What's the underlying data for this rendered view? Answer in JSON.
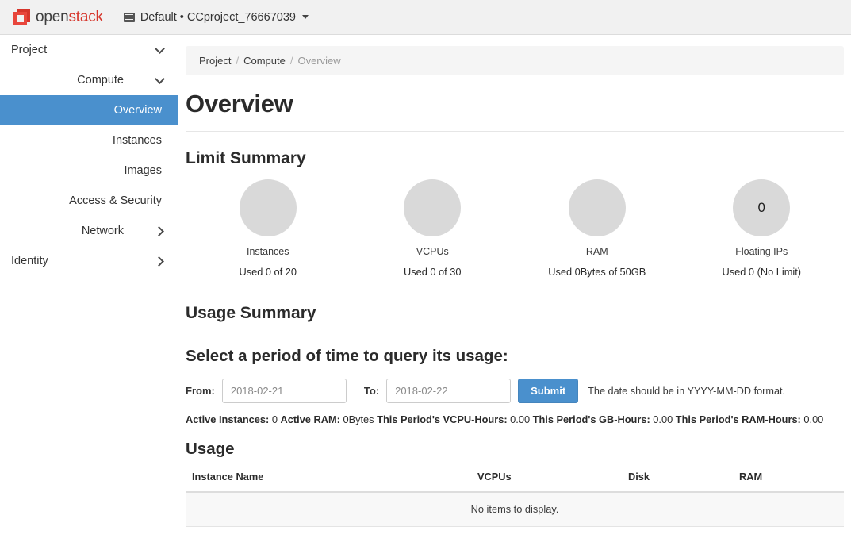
{
  "topbar": {
    "logo_open": "open",
    "logo_stack": "stack",
    "logo_icon": "openstack-cube-icon",
    "switcher_icon": "th-list-icon",
    "switcher_label": "Default • CCproject_76667039",
    "caret_icon": "caret-down-icon"
  },
  "sidebar": {
    "items": [
      {
        "label": "Project",
        "level": 0,
        "chevron": "down",
        "active": false
      },
      {
        "label": "Compute",
        "level": 1,
        "chevron": "down",
        "active": false
      },
      {
        "label": "Overview",
        "level": 2,
        "chevron": "none",
        "active": true
      },
      {
        "label": "Instances",
        "level": 2,
        "chevron": "none",
        "active": false
      },
      {
        "label": "Images",
        "level": 2,
        "chevron": "none",
        "active": false
      },
      {
        "label": "Access & Security",
        "level": 2,
        "chevron": "none",
        "active": false
      },
      {
        "label": "Network",
        "level": 1,
        "chevron": "right",
        "active": false
      },
      {
        "label": "Identity",
        "level": 0,
        "chevron": "right",
        "active": false
      }
    ]
  },
  "breadcrumb": {
    "items": [
      "Project",
      "Compute",
      "Overview"
    ],
    "separator": "/"
  },
  "page": {
    "title": "Overview",
    "limit_summary_heading": "Limit Summary",
    "usage_summary_heading": "Usage Summary",
    "select_period_heading": "Select a period of time to query its usage:",
    "usage_heading": "Usage"
  },
  "limit_summary": [
    {
      "label": "Instances",
      "center_text": "",
      "sub": "Used 0 of 20"
    },
    {
      "label": "VCPUs",
      "center_text": "",
      "sub": "Used 0 of 30"
    },
    {
      "label": "RAM",
      "center_text": "",
      "sub": "Used 0Bytes of 50GB"
    },
    {
      "label": "Floating IPs",
      "center_text": "0",
      "sub": "Used 0 (No Limit)"
    }
  ],
  "form": {
    "from_label": "From:",
    "from_value": "2018-02-21",
    "from_placeholder": "YYYY-MM-DD",
    "to_label": "To:",
    "to_value": "2018-02-22",
    "to_placeholder": "YYYY-MM-DD",
    "submit_label": "Submit",
    "hint": "The date should be in YYYY-MM-DD format."
  },
  "stats": [
    {
      "label": "Active Instances:",
      "value": "0"
    },
    {
      "label": "Active RAM:",
      "value": "0Bytes"
    },
    {
      "label": "This Period's VCPU-Hours:",
      "value": "0.00"
    },
    {
      "label": "This Period's GB-Hours:",
      "value": "0.00"
    },
    {
      "label": "This Period's RAM-Hours:",
      "value": "0.00"
    }
  ],
  "usage_table": {
    "columns": [
      "Instance Name",
      "VCPUs",
      "Disk",
      "RAM"
    ],
    "rows": [],
    "empty_message": "No items to display."
  },
  "colors": {
    "accent_blue": "#4a90cd",
    "brand_red": "#d6352b",
    "donut_gray": "#d9d9d9",
    "breadcrumb_bg": "#f5f5f5",
    "topbar_bg": "#f1f1f1"
  }
}
